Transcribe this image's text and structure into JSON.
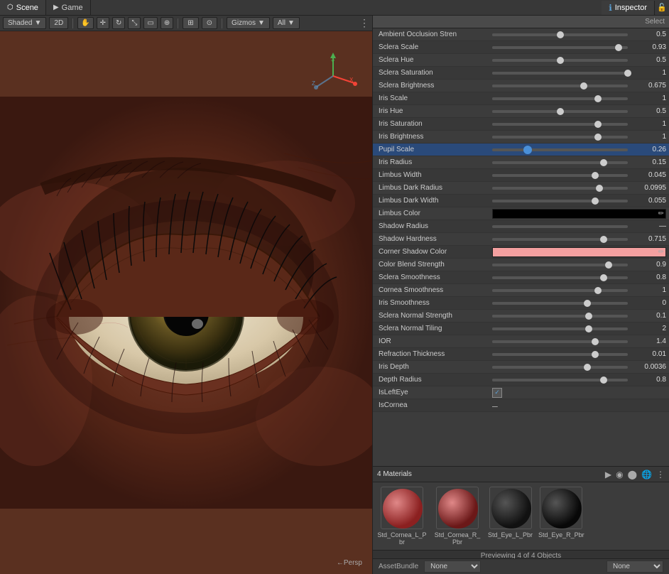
{
  "tabs": [
    {
      "id": "scene",
      "label": "Scene",
      "icon": "scene"
    },
    {
      "id": "game",
      "label": "Game",
      "icon": "game"
    }
  ],
  "scene_toolbar": {
    "shading": "Shaded",
    "mode": "2D",
    "gizmos": "Gizmos",
    "all": "All"
  },
  "inspector": {
    "title": "Inspector",
    "select_label": "Select",
    "properties": [
      {
        "label": "Ambient Occlusion Stren",
        "value": "0.5",
        "slider_pct": 0.5,
        "type": "slider"
      },
      {
        "label": "Sclera Scale",
        "value": "0.93",
        "slider_pct": 0.93,
        "type": "slider"
      },
      {
        "label": "Sclera Hue",
        "value": "0.5",
        "slider_pct": 0.5,
        "type": "slider"
      },
      {
        "label": "Sclera Saturation",
        "value": "1",
        "slider_pct": 1.0,
        "type": "slider"
      },
      {
        "label": "Sclera Brightness",
        "value": "0.675",
        "slider_pct": 0.675,
        "type": "slider"
      },
      {
        "label": "Iris Scale",
        "value": "1",
        "slider_pct": 0.78,
        "type": "slider"
      },
      {
        "label": "Iris Hue",
        "value": "0.5",
        "slider_pct": 0.5,
        "type": "slider"
      },
      {
        "label": "Iris Saturation",
        "value": "1",
        "slider_pct": 0.78,
        "type": "slider"
      },
      {
        "label": "Iris Brightness",
        "value": "1",
        "slider_pct": 0.78,
        "type": "slider"
      },
      {
        "label": "Pupil Scale",
        "value": "0.26",
        "slider_pct": 0.26,
        "type": "slider",
        "highlighted": true
      },
      {
        "label": "Iris Radius",
        "value": "0.15",
        "slider_pct": 0.82,
        "type": "slider"
      },
      {
        "label": "Limbus Width",
        "value": "0.045",
        "slider_pct": 0.76,
        "type": "slider"
      },
      {
        "label": "Limbus Dark Radius",
        "value": "0.0995",
        "slider_pct": 0.79,
        "type": "slider"
      },
      {
        "label": "Limbus Dark Width",
        "value": "0.055",
        "slider_pct": 0.76,
        "type": "slider"
      },
      {
        "label": "Limbus Color",
        "value": "",
        "type": "color",
        "color": "#000000"
      },
      {
        "label": "Shadow Radius",
        "value": "—",
        "slider_pct": 0,
        "type": "dash"
      },
      {
        "label": "Shadow Hardness",
        "value": "0.715",
        "slider_pct": 0.82,
        "type": "slider"
      },
      {
        "label": "Corner Shadow Color",
        "value": "",
        "type": "color",
        "color": "#f4a0a0"
      },
      {
        "label": "Color Blend Strength",
        "value": "0.9",
        "slider_pct": 0.86,
        "type": "slider"
      },
      {
        "label": "Sclera Smoothness",
        "value": "0.8",
        "slider_pct": 0.82,
        "type": "slider"
      },
      {
        "label": "Cornea Smoothness",
        "value": "1",
        "slider_pct": 0.78,
        "type": "slider"
      },
      {
        "label": "Iris Smoothness",
        "value": "0",
        "slider_pct": 0.7,
        "type": "slider"
      },
      {
        "label": "Sclera Normal Strength",
        "value": "0.1",
        "slider_pct": 0.71,
        "type": "slider"
      },
      {
        "label": "Sclera Normal Tiling",
        "value": "2",
        "slider_pct": 0.71,
        "type": "slider"
      },
      {
        "label": "IOR",
        "value": "1.4",
        "slider_pct": 0.76,
        "type": "slider"
      },
      {
        "label": "Refraction Thickness",
        "value": "0.01",
        "slider_pct": 0.76,
        "type": "slider"
      },
      {
        "label": "Iris Depth",
        "value": "0.0036",
        "slider_pct": 0.7,
        "type": "slider"
      },
      {
        "label": "Depth Radius",
        "value": "0.8",
        "slider_pct": 0.82,
        "type": "slider"
      },
      {
        "label": "IsLeftEye",
        "value": "",
        "type": "checkbox",
        "checked": true
      },
      {
        "label": "IsCornea",
        "value": "—",
        "type": "dash2"
      }
    ]
  },
  "materials": {
    "title": "4 Materials",
    "preview_label": "Previewing 4 of 4 Objects",
    "items": [
      {
        "label": "Std_Cornea_L_Pbr",
        "color": "#8b2020"
      },
      {
        "label": "Std_Cornea_R_Pbr",
        "color": "#6b1818"
      },
      {
        "label": "Std_Eye_L_Pbr",
        "color": "#111111"
      },
      {
        "label": "Std_Eye_R_Pbr",
        "color": "#080808"
      }
    ]
  },
  "status_bar": {
    "asset_bundle_label": "AssetBundle",
    "none_label": "None",
    "none2_label": "None"
  }
}
